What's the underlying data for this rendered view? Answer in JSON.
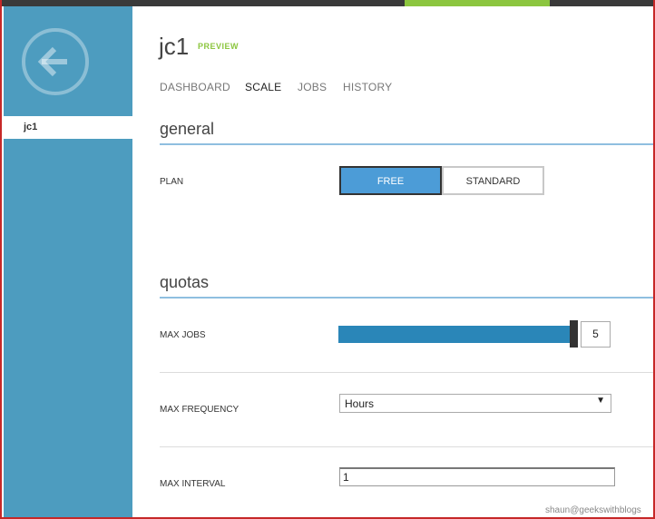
{
  "header": {
    "title": "jc1",
    "badge": "PREVIEW",
    "tabs": [
      {
        "label": "DASHBOARD"
      },
      {
        "label": "SCALE"
      },
      {
        "label": "JOBS"
      },
      {
        "label": "HISTORY"
      }
    ],
    "active_tab": "SCALE"
  },
  "sidebar": {
    "back_icon": "arrow-left-icon",
    "items": [
      {
        "label": "jc1"
      }
    ]
  },
  "general": {
    "title": "general",
    "plan_label": "PLAN",
    "plan_options": [
      "FREE",
      "STANDARD"
    ],
    "plan_selected": "FREE"
  },
  "quotas": {
    "title": "quotas",
    "max_jobs_label": "MAX JOBS",
    "max_jobs_value": "5",
    "max_jobs_fraction": 1.0,
    "max_frequency_label": "MAX FREQUENCY",
    "max_frequency_value": "Hours",
    "max_interval_label": "MAX INTERVAL",
    "max_interval_value": "1"
  },
  "watermark": "shaun@geekswithblogs",
  "colors": {
    "sidebar": "#4d9cbf",
    "accent_green": "#8cc63f",
    "selected_blue": "#4c9cd7",
    "slider_blue": "#2a86b8",
    "section_line": "#8fbfe0"
  }
}
